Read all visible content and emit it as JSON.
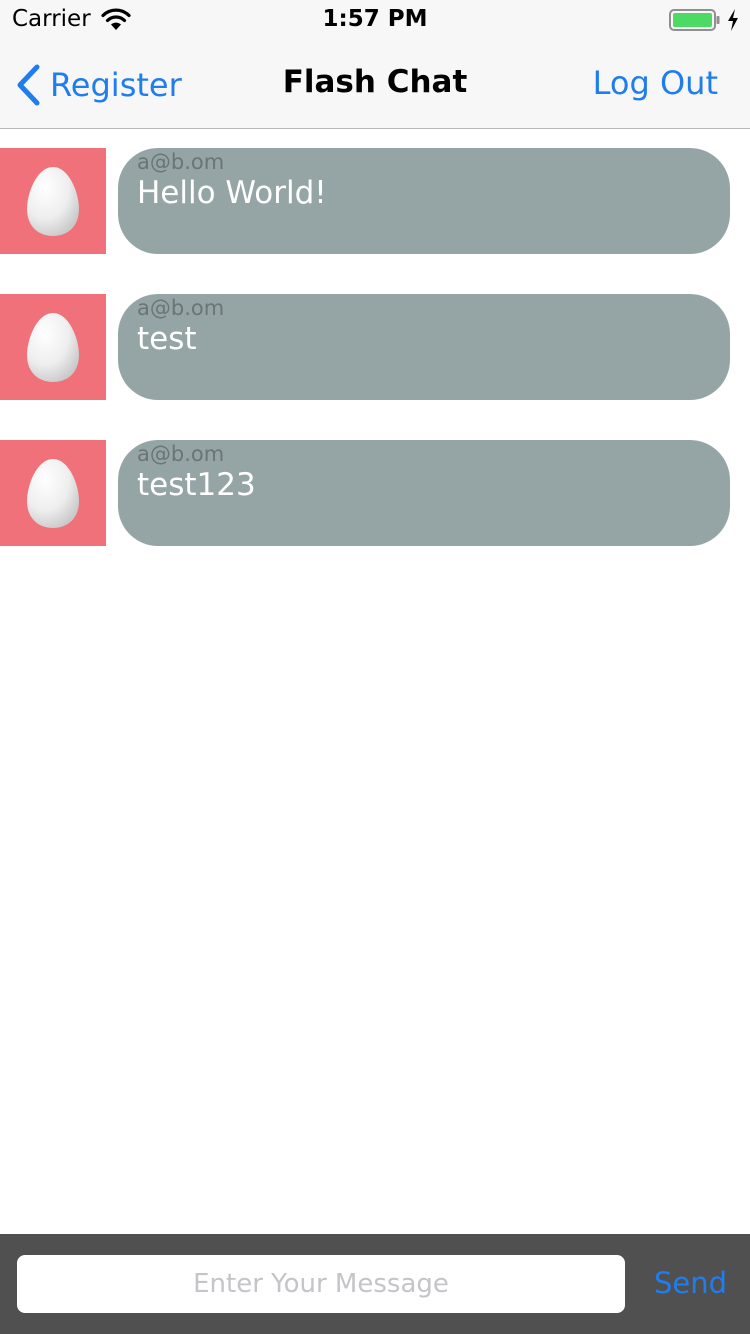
{
  "status_bar": {
    "carrier": "Carrier",
    "time": "1:57 PM",
    "wifi_icon": "wifi-icon",
    "battery_icon": "battery-icon",
    "battery_color": "#4cd964"
  },
  "nav": {
    "back_label": "Register",
    "back_icon": "chevron-left-icon",
    "title": "Flash Chat",
    "logout_label": "Log Out",
    "tint_color": "#1f7ded"
  },
  "messages": [
    {
      "sender": "a@b.om",
      "body": "Hello World!",
      "avatar_icon": "egg-icon"
    },
    {
      "sender": "a@b.om",
      "body": "test",
      "avatar_icon": "egg-icon"
    },
    {
      "sender": "a@b.om",
      "body": "test123",
      "avatar_icon": "egg-icon"
    }
  ],
  "composer": {
    "placeholder": "Enter Your Message",
    "value": "",
    "send_label": "Send"
  },
  "colors": {
    "avatar_bg": "#f0717a",
    "bubble_bg": "#95a5a6",
    "composer_bg": "#505050"
  }
}
